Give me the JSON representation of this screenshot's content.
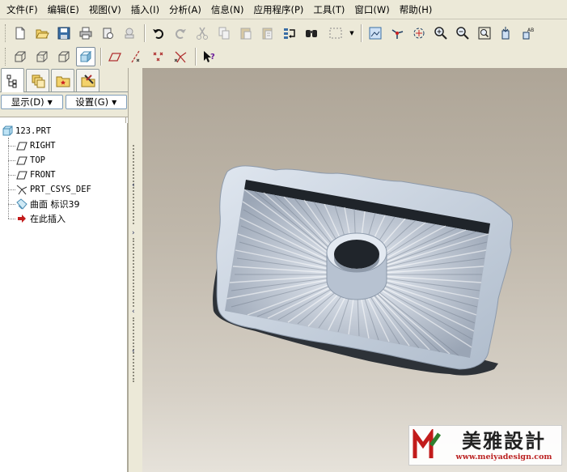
{
  "menubar": {
    "items": [
      "文件(F)",
      "编辑(E)",
      "视图(V)",
      "插入(I)",
      "分析(A)",
      "信息(N)",
      "应用程序(P)",
      "工具(T)",
      "窗口(W)",
      "帮助(H)"
    ]
  },
  "toolbar_top": {
    "icons": [
      "new-file-icon",
      "open-folder-icon",
      "save-icon",
      "print-icon",
      "close-window-icon",
      "erase-icon",
      "undo-icon",
      "redo-icon",
      "cut-icon",
      "copy-icon",
      "paste-icon",
      "paste-special-icon",
      "regenerate-icon",
      "find-icon",
      "select-box-icon",
      "repaint-icon",
      "spin-center-icon",
      "orient-icon",
      "zoom-in-icon",
      "zoom-out-icon",
      "refit-icon",
      "reorient-icon",
      "saved-views-icon"
    ]
  },
  "toolbar_second": {
    "icons": [
      "wireframe-icon",
      "hidden-line-icon",
      "no-hidden-icon",
      "shading-icon",
      "datum-planes-icon",
      "datum-axes-icon",
      "datum-points-icon",
      "coordinate-systems-icon",
      "context-help-icon"
    ]
  },
  "left_panel": {
    "tabs": [
      "model-tree-tab",
      "layers-tab",
      "favorites-tab",
      "tools-tab"
    ],
    "show_dropdown": "显示(D)",
    "settings_dropdown": "设置(G)"
  },
  "model_tree": {
    "root": "123.PRT",
    "items": [
      {
        "label": "RIGHT",
        "icon": "datum-plane-icon"
      },
      {
        "label": "TOP",
        "icon": "datum-plane-icon"
      },
      {
        "label": "FRONT",
        "icon": "datum-plane-icon"
      },
      {
        "label": "PRT_CSYS_DEF",
        "icon": "csys-icon"
      },
      {
        "label": "曲面 标识39",
        "icon": "surface-icon"
      },
      {
        "label": "在此插入",
        "icon": "insert-arrow-icon"
      }
    ]
  },
  "watermark": {
    "title": "美雅設計",
    "url": "www.meiyadesign.com"
  },
  "colors": {
    "model_surface": "#b9c4d3",
    "model_shadow": "#2a2f36",
    "background_top": "#aea597",
    "background_bottom": "#e6e2da",
    "accent": "#316ac5"
  }
}
